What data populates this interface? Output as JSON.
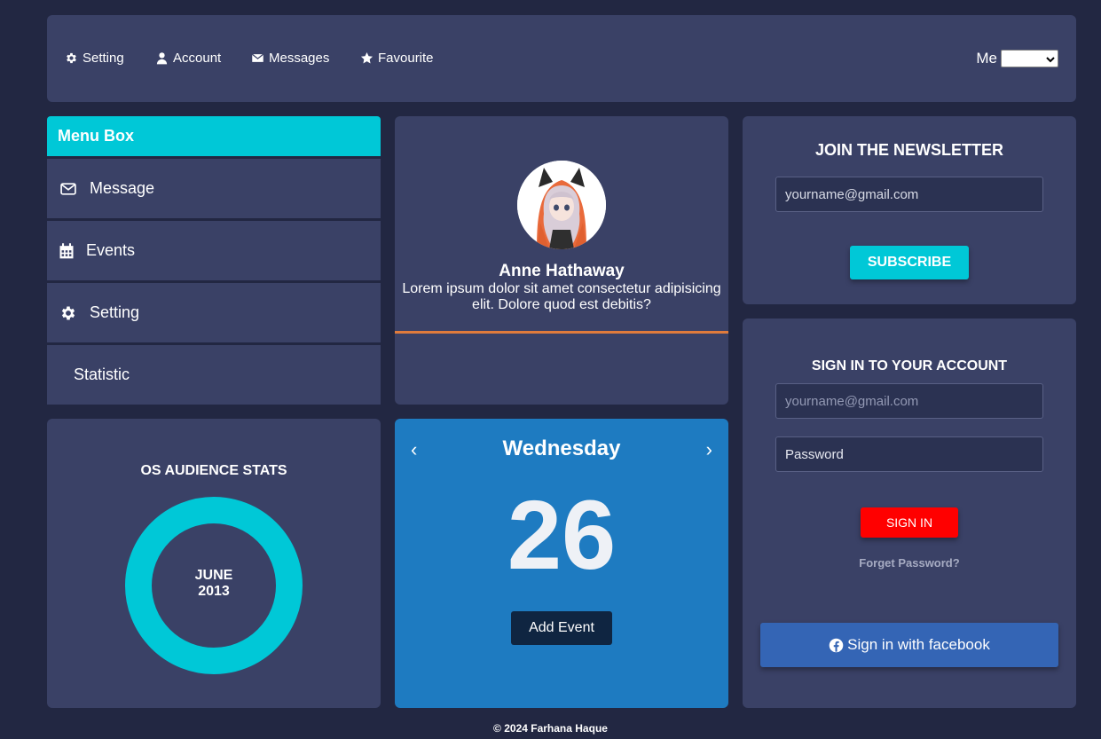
{
  "nav": {
    "items": [
      {
        "label": "Setting",
        "icon": "gear-icon"
      },
      {
        "label": "Account",
        "icon": "user-icon"
      },
      {
        "label": "Messages",
        "icon": "envelope-icon"
      },
      {
        "label": "Favourite",
        "icon": "star-icon"
      }
    ],
    "me_label": "Me",
    "me_selected": ""
  },
  "menu": {
    "title": "Menu Box",
    "items": [
      {
        "label": "Message",
        "icon": "envelope-icon"
      },
      {
        "label": "Events",
        "icon": "calendar-icon"
      },
      {
        "label": "Setting",
        "icon": "gear-icon"
      },
      {
        "label": "Statistic",
        "icon": ""
      }
    ]
  },
  "profile": {
    "name": "Anne Hathaway",
    "bio": "Lorem ipsum dolor sit amet consectetur adipisicing elit. Dolore quod est debitis?"
  },
  "newsletter": {
    "title": "JOIN THE NEWSLETTER",
    "email_value": "yourname@gmail.com",
    "button": "SUBSCRIBE"
  },
  "signin": {
    "title": "SIGN IN TO YOUR ACCOUNT",
    "email_placeholder": "yourname@gmail.com",
    "password_value": "Password",
    "button": "SIGN IN",
    "forget": "Forget Password?",
    "facebook": "Sign in with facebook"
  },
  "os_stats": {
    "title": "OS AUDIENCE STATS",
    "month": "JUNE",
    "year": "2013"
  },
  "calendar": {
    "prev": "‹",
    "next": "›",
    "day": "Wednesday",
    "date": "26",
    "button": "Add Event"
  },
  "footer": "© 2024 Farhana Haque",
  "colors": {
    "background": "#222742",
    "panel": "#3a4166",
    "accent": "#00c8d7",
    "calendar": "#1e7bc1",
    "signin_button": "#ff0000",
    "facebook": "#3465b5",
    "profile_divider": "#e07b3c"
  }
}
